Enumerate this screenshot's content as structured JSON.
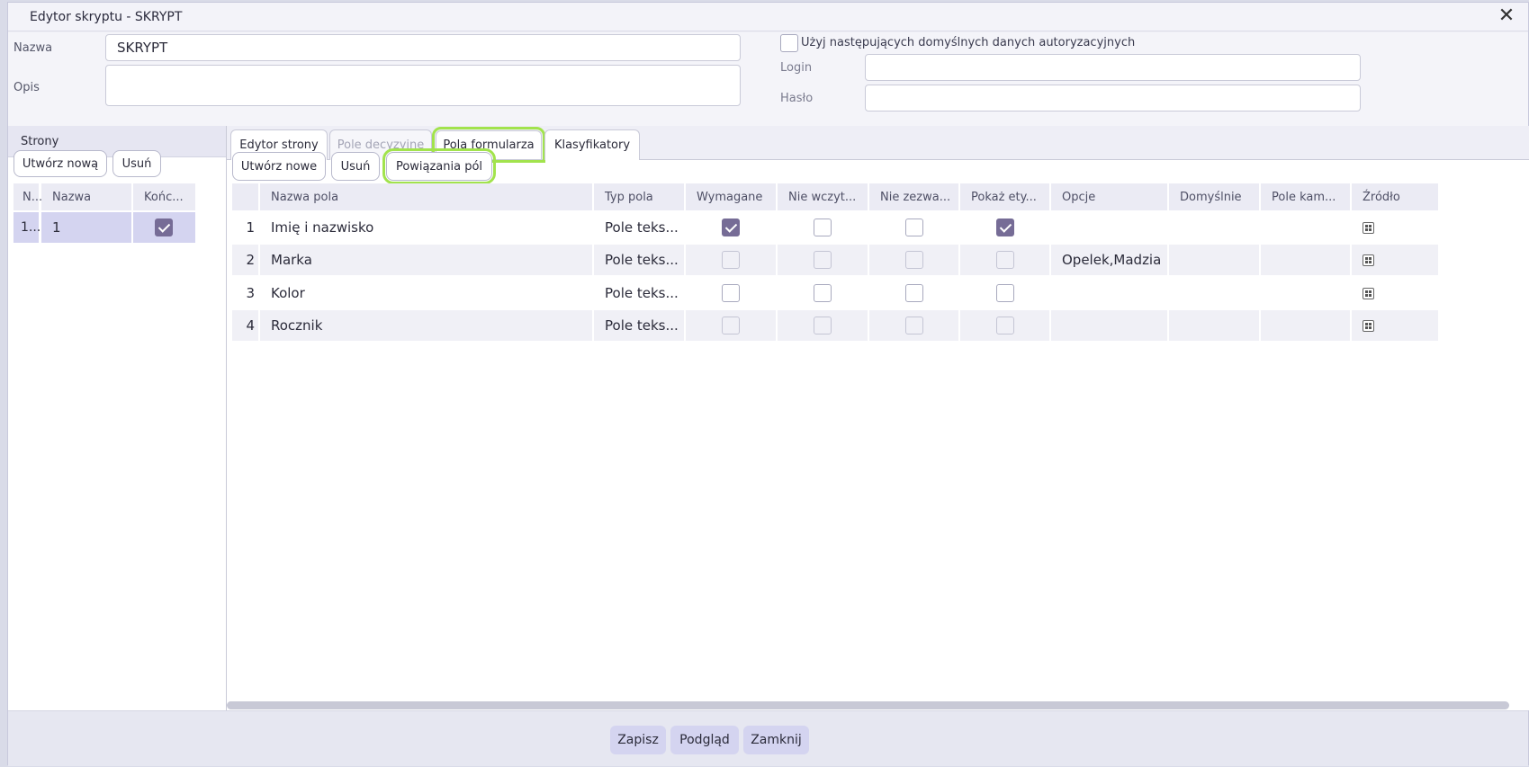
{
  "window": {
    "title": "Edytor skryptu - SKRYPT",
    "close_glyph": "✕"
  },
  "form": {
    "name_label": "Nazwa",
    "name_value": "SKRYPT",
    "desc_label": "Opis",
    "desc_value": "",
    "default_auth_label": "Użyj następujących domyślnych danych autoryzacyjnych",
    "default_auth_checked": false,
    "login_label": "Login",
    "login_value": "",
    "password_label": "Hasło",
    "password_value": ""
  },
  "pages": {
    "header": "Strony",
    "create_label": "Utwórz nową",
    "delete_label": "Usuń",
    "columns": [
      "N...",
      "Nazwa",
      "Końc..."
    ],
    "rows": [
      {
        "no": "1...",
        "name": "1",
        "final": true
      }
    ]
  },
  "tabs": [
    {
      "label": "Edytor strony",
      "state": "normal"
    },
    {
      "label": "Pole decyzyjne",
      "state": "disabled"
    },
    {
      "label": "Pola formularza",
      "state": "active"
    },
    {
      "label": "Klasyfikatory",
      "state": "normal"
    }
  ],
  "fields_toolbar": {
    "create_label": "Utwórz nowe",
    "delete_label": "Usuń",
    "links_label": "Powiązania pól"
  },
  "fields_table": {
    "columns": [
      "Nazwa pola",
      "Typ pola",
      "Wymagane",
      "Nie wczyt...",
      "Nie zezwa...",
      "Pokaż ety...",
      "Opcje",
      "Domyślnie",
      "Pole kam...",
      "Źródło"
    ],
    "rows": [
      {
        "no": "1",
        "name": "Imię i nazwisko",
        "type": "Pole teks...",
        "required": true,
        "no_load": false,
        "no_allow": false,
        "show_label": true,
        "options": "",
        "default": "",
        "camp_field": ""
      },
      {
        "no": "2",
        "name": "Marka",
        "type": "Pole teks...",
        "required": false,
        "no_load": false,
        "no_allow": false,
        "show_label": false,
        "options": "Opelek,Madzia",
        "default": "",
        "camp_field": ""
      },
      {
        "no": "3",
        "name": "Kolor",
        "type": "Pole teks...",
        "required": false,
        "no_load": false,
        "no_allow": false,
        "show_label": false,
        "options": "",
        "default": "",
        "camp_field": ""
      },
      {
        "no": "4",
        "name": "Rocznik",
        "type": "Pole teks...",
        "required": false,
        "no_load": false,
        "no_allow": false,
        "show_label": false,
        "options": "",
        "default": "",
        "camp_field": ""
      }
    ]
  },
  "footer": {
    "save_label": "Zapisz",
    "preview_label": "Podgląd",
    "close_label": "Zamknij"
  },
  "colors": {
    "accent": "#766c96",
    "highlight": "#a2e34d",
    "primary_button": "#d4d4f0",
    "selected_row": "#d4d4f0"
  }
}
